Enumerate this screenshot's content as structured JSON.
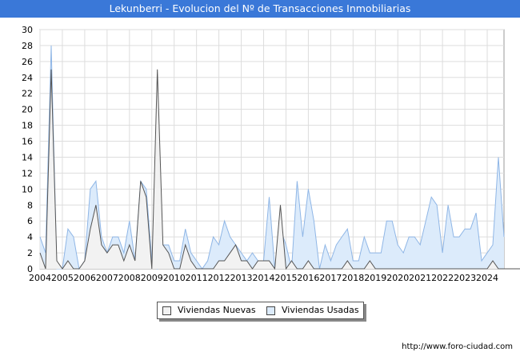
{
  "header": {
    "title": "Lekunberri - Evolucion del Nº de Transacciones Inmobiliarias"
  },
  "footer": {
    "source": "http://www.foro-ciudad.com"
  },
  "colors": {
    "nuevas_fill": "#f2f2f2",
    "nuevas_line": "#555555",
    "usadas_fill": "#dcebfb",
    "usadas_line": "#8fb6e6",
    "title_bg": "#3a78d8"
  },
  "chart_data": {
    "type": "area",
    "title": "Lekunberri - Evolucion del Nº de Transacciones Inmobiliarias",
    "x_unit": "quarter",
    "x_start": "2004-Q1",
    "xlim": [
      2004,
      2024.75
    ],
    "ylim": [
      0,
      30
    ],
    "y_ticks": [
      0,
      2,
      4,
      6,
      8,
      10,
      12,
      14,
      16,
      18,
      20,
      22,
      24,
      26,
      28,
      30
    ],
    "x_tick_labels": [
      "2004",
      "2005",
      "2006",
      "2007",
      "2008",
      "2009",
      "2010",
      "2011",
      "2012",
      "2013",
      "2014",
      "2015",
      "2016",
      "2017",
      "2018",
      "2019",
      "2020",
      "2021",
      "2022",
      "2023",
      "2024"
    ],
    "grid": true,
    "legend_position": "bottom-center",
    "series": [
      {
        "name": "Viviendas Nuevas",
        "values": [
          2,
          0,
          25,
          1,
          0,
          1,
          0,
          0,
          1,
          5,
          8,
          3,
          2,
          3,
          3,
          1,
          3,
          1,
          11,
          9,
          0,
          25,
          3,
          2,
          0,
          0,
          3,
          1,
          0,
          0,
          0,
          0,
          1,
          1,
          2,
          3,
          1,
          1,
          0,
          1,
          1,
          1,
          0,
          8,
          0,
          1,
          0,
          0,
          1,
          0,
          0,
          0,
          0,
          0,
          0,
          1,
          0,
          0,
          0,
          1,
          0,
          0,
          0,
          0,
          0,
          0,
          0,
          0,
          0,
          0,
          0,
          0,
          0,
          0,
          0,
          0,
          0,
          0,
          0,
          0,
          0,
          1,
          0,
          0,
          0,
          0,
          0,
          1,
          0
        ]
      },
      {
        "name": "Viviendas Usadas",
        "values": [
          4,
          2,
          28,
          0,
          0,
          5,
          4,
          0,
          1,
          10,
          11,
          4,
          2,
          4,
          4,
          2,
          6,
          1,
          11,
          10,
          1,
          0,
          3,
          3,
          1,
          1,
          5,
          2,
          1,
          0,
          1,
          4,
          3,
          6,
          4,
          3,
          2,
          1,
          2,
          1,
          1,
          9,
          0,
          5,
          3,
          0,
          11,
          4,
          10,
          6,
          0,
          3,
          1,
          3,
          4,
          5,
          1,
          1,
          4,
          2,
          2,
          2,
          6,
          6,
          3,
          2,
          4,
          4,
          3,
          6,
          9,
          8,
          2,
          8,
          4,
          4,
          5,
          5,
          7,
          1,
          2,
          3,
          14,
          4
        ]
      }
    ]
  }
}
